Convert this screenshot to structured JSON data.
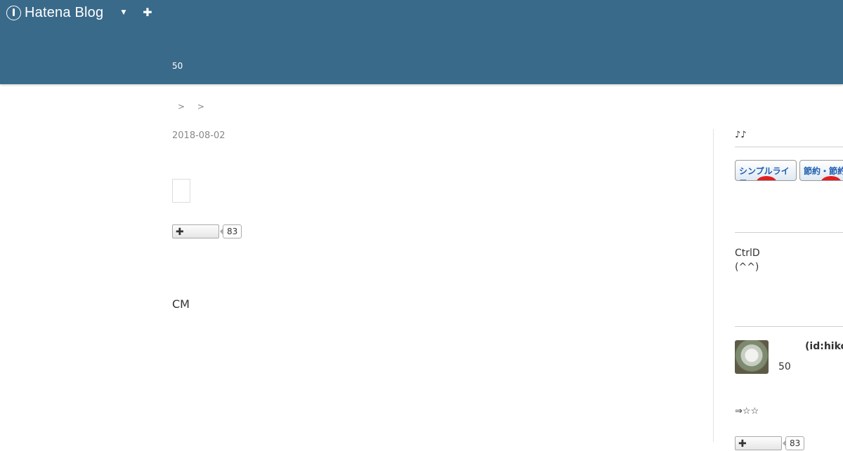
{
  "header": {
    "logo_text": "Hatena Blog",
    "blog_description": "50"
  },
  "breadcrumb": {
    "separators": [
      ">",
      ">"
    ]
  },
  "entry": {
    "date": "2018-08-02",
    "bookmark_count": "83",
    "text": "CM"
  },
  "sidebar": {
    "title": "♪♪",
    "banners": [
      {
        "label": "シンプルライフ"
      },
      {
        "label": "節約・節約"
      }
    ],
    "tip_line1": "CtrlD",
    "tip_line2": "(^^)",
    "profile": {
      "id": "(id:hiko",
      "number": "50"
    },
    "arrow_text": "⇒☆☆",
    "bookmark_count": "83"
  },
  "colors": {
    "header_bg": "#3a6a8a",
    "banner_text": "#1f5fb0"
  }
}
